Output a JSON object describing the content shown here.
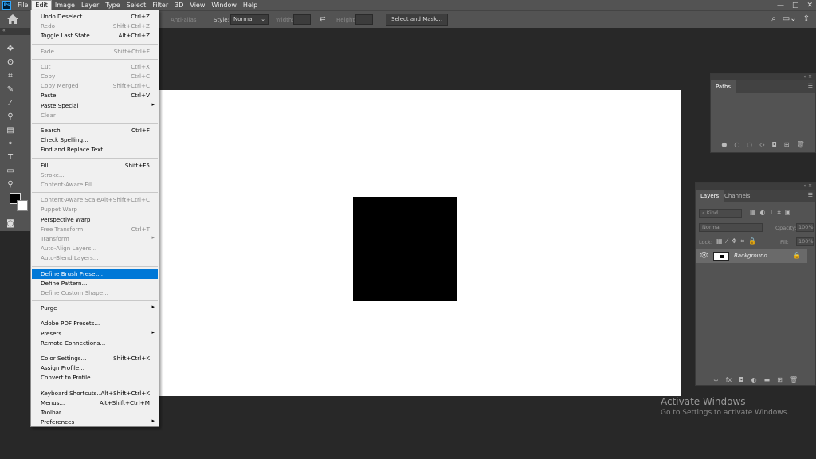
{
  "menubar": {
    "logo": "Ps",
    "items": [
      "File",
      "Edit",
      "Image",
      "Layer",
      "Type",
      "Select",
      "Filter",
      "3D",
      "View",
      "Window",
      "Help"
    ],
    "window_controls": [
      "—",
      "□",
      "✕"
    ]
  },
  "options": {
    "anti_alias": "Anti-alias",
    "style_label": "Style:",
    "style_value": "Normal",
    "width_label": "Width:",
    "height_label": "Height:",
    "select_mask": "Select and Mask..."
  },
  "edit_menu": [
    {
      "label": "Undo Deselect",
      "shortcut": "Ctrl+Z",
      "enabled": true
    },
    {
      "label": "Redo",
      "shortcut": "Shift+Ctrl+Z",
      "enabled": false
    },
    {
      "label": "Toggle Last State",
      "shortcut": "Alt+Ctrl+Z",
      "enabled": true
    },
    {
      "sep": true
    },
    {
      "label": "Fade...",
      "shortcut": "Shift+Ctrl+F",
      "enabled": false
    },
    {
      "sep": true
    },
    {
      "label": "Cut",
      "shortcut": "Ctrl+X",
      "enabled": false
    },
    {
      "label": "Copy",
      "shortcut": "Ctrl+C",
      "enabled": false
    },
    {
      "label": "Copy Merged",
      "shortcut": "Shift+Ctrl+C",
      "enabled": false
    },
    {
      "label": "Paste",
      "shortcut": "Ctrl+V",
      "enabled": true
    },
    {
      "label": "Paste Special",
      "submenu": true,
      "enabled": true
    },
    {
      "label": "Clear",
      "enabled": false
    },
    {
      "sep": true
    },
    {
      "label": "Search",
      "shortcut": "Ctrl+F",
      "enabled": true
    },
    {
      "label": "Check Spelling...",
      "enabled": true
    },
    {
      "label": "Find and Replace Text...",
      "enabled": true
    },
    {
      "sep": true
    },
    {
      "label": "Fill...",
      "shortcut": "Shift+F5",
      "enabled": true
    },
    {
      "label": "Stroke...",
      "enabled": false
    },
    {
      "label": "Content-Aware Fill...",
      "enabled": false
    },
    {
      "sep": true
    },
    {
      "label": "Content-Aware Scale",
      "shortcut": "Alt+Shift+Ctrl+C",
      "enabled": false
    },
    {
      "label": "Puppet Warp",
      "enabled": false
    },
    {
      "label": "Perspective Warp",
      "enabled": true
    },
    {
      "label": "Free Transform",
      "shortcut": "Ctrl+T",
      "enabled": false
    },
    {
      "label": "Transform",
      "submenu": true,
      "enabled": false
    },
    {
      "label": "Auto-Align Layers...",
      "enabled": false
    },
    {
      "label": "Auto-Blend Layers...",
      "enabled": false
    },
    {
      "sep": true
    },
    {
      "label": "Define Brush Preset...",
      "enabled": true,
      "highlighted": true
    },
    {
      "label": "Define Pattern...",
      "enabled": true
    },
    {
      "label": "Define Custom Shape...",
      "enabled": false
    },
    {
      "sep": true
    },
    {
      "label": "Purge",
      "submenu": true,
      "enabled": true
    },
    {
      "sep": true
    },
    {
      "label": "Adobe PDF Presets...",
      "enabled": true
    },
    {
      "label": "Presets",
      "submenu": true,
      "enabled": true
    },
    {
      "label": "Remote Connections...",
      "enabled": true
    },
    {
      "sep": true
    },
    {
      "label": "Color Settings...",
      "shortcut": "Shift+Ctrl+K",
      "enabled": true
    },
    {
      "label": "Assign Profile...",
      "enabled": true
    },
    {
      "label": "Convert to Profile...",
      "enabled": true
    },
    {
      "sep": true
    },
    {
      "label": "Keyboard Shortcuts...",
      "shortcut": "Alt+Shift+Ctrl+K",
      "enabled": true
    },
    {
      "label": "Menus...",
      "shortcut": "Alt+Shift+Ctrl+M",
      "enabled": true
    },
    {
      "label": "Toolbar...",
      "enabled": true
    },
    {
      "label": "Preferences",
      "submenu": true,
      "enabled": true
    }
  ],
  "paths_panel": {
    "tab": "Paths"
  },
  "layers_panel": {
    "tabs": [
      "Layers",
      "Channels"
    ],
    "filter_placeholder": "Kind",
    "blend_mode": "Normal",
    "opacity_label": "Opacity:",
    "opacity_value": "100%",
    "lock_label": "Lock:",
    "fill_label": "Fill:",
    "fill_value": "100%",
    "layer_name": "Background"
  },
  "activate_windows": {
    "title": "Activate Windows",
    "subtitle": "Go to Settings to activate Windows."
  },
  "colors": {
    "accent": "#0078d7",
    "ui_bg": "#535353",
    "workspace": "#282828"
  }
}
